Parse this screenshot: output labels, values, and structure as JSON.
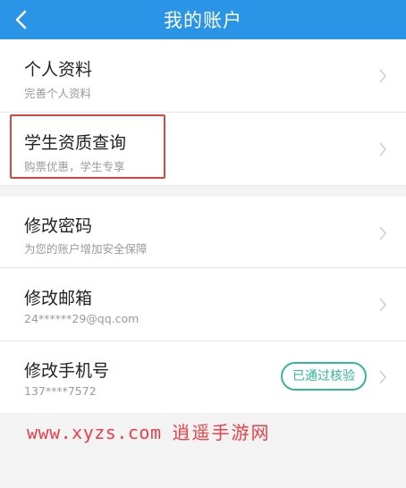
{
  "header": {
    "title": "我的账户"
  },
  "rows": [
    {
      "title": "个人资料",
      "subtitle": "完善个人资料"
    },
    {
      "title": "学生资质查询",
      "subtitle": "购票优惠，学生专享"
    },
    {
      "title": "修改密码",
      "subtitle": "为您的账户增加安全保障"
    },
    {
      "title": "修改邮箱",
      "subtitle": "24******29@qq.com"
    },
    {
      "title": "修改手机号",
      "subtitle": "137****7572",
      "badge": "已通过核验"
    }
  ],
  "watermark": {
    "url": "www.xyzs.com",
    "name": "逍遥手游网"
  },
  "colors": {
    "header": "#2a95e6",
    "highlight": "#d9463e",
    "badge": "#35b59a",
    "watermark": "#e8404a"
  }
}
